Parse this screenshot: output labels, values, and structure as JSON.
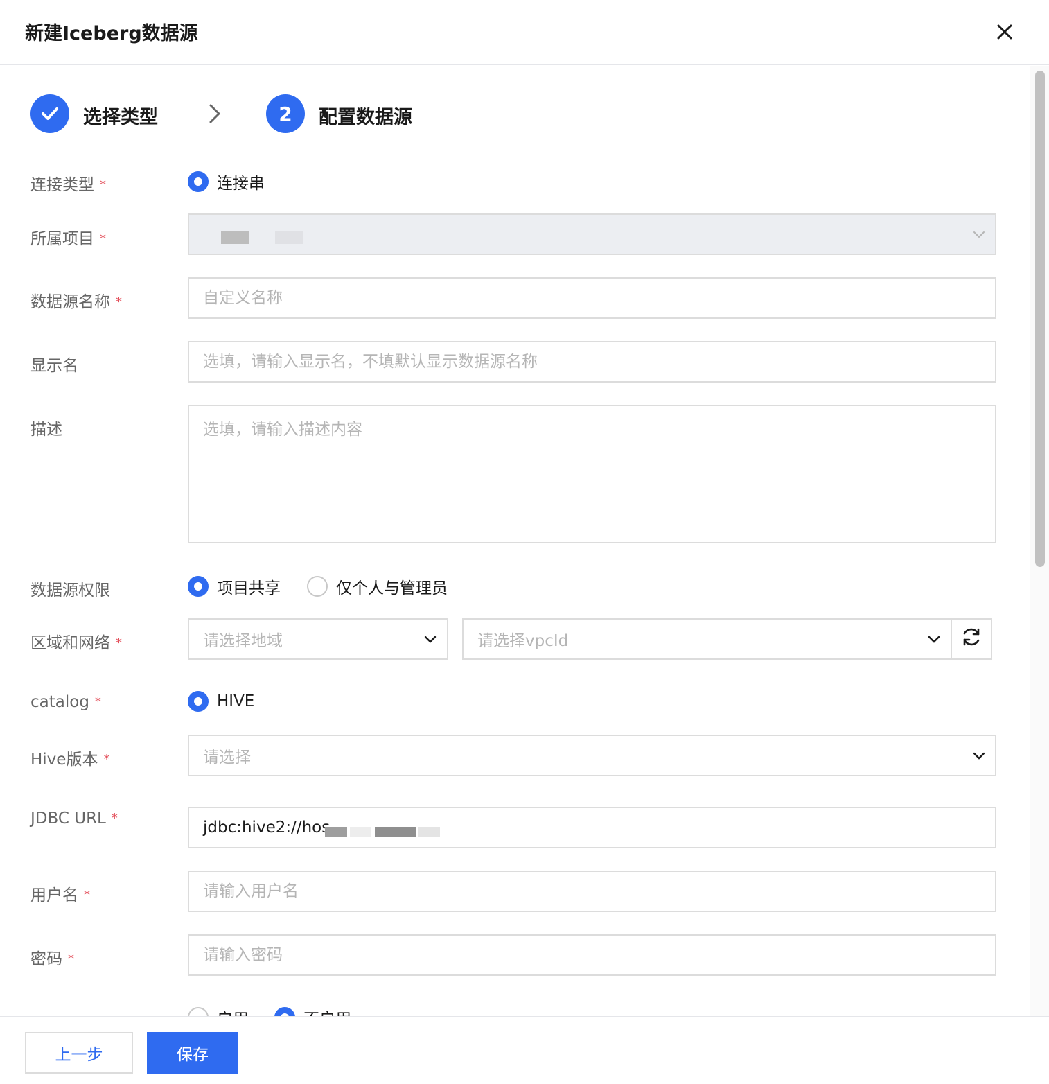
{
  "dialog": {
    "title": "新建Iceberg数据源"
  },
  "steps": [
    {
      "label": "选择类型",
      "state": "done"
    },
    {
      "number": "2",
      "label": "配置数据源",
      "state": "active"
    }
  ],
  "form": {
    "connection_type": {
      "label": "连接类型",
      "option": "连接串"
    },
    "project": {
      "label": "所属项目"
    },
    "name": {
      "label": "数据源名称",
      "placeholder": "自定义名称"
    },
    "display_name": {
      "label": "显示名",
      "placeholder": "选填，请输入显示名，不填默认显示数据源名称"
    },
    "description": {
      "label": "描述",
      "placeholder": "选填，请输入描述内容"
    },
    "permission": {
      "label": "数据源权限",
      "options": [
        "项目共享",
        "仅个人与管理员"
      ]
    },
    "region_network": {
      "label": "区域和网络",
      "region_placeholder": "请选择地域",
      "vpc_placeholder": "请选择vpcId"
    },
    "catalog": {
      "label": "catalog",
      "option": "HIVE"
    },
    "hive_version": {
      "label": "Hive版本",
      "placeholder": "请选择"
    },
    "jdbc_url": {
      "label": "JDBC URL",
      "value": "jdbc:hive2://hos"
    },
    "username": {
      "label": "用户名",
      "placeholder": "请输入用户名"
    },
    "password": {
      "label": "密码",
      "placeholder": "请输入密码"
    },
    "hive_metadb": {
      "options": [
        "启用",
        "不启用"
      ]
    }
  },
  "footer": {
    "prev_label": "上一步",
    "save_label": "保存"
  },
  "colors": {
    "primary": "#2f6bf0",
    "required": "#e34d59"
  }
}
